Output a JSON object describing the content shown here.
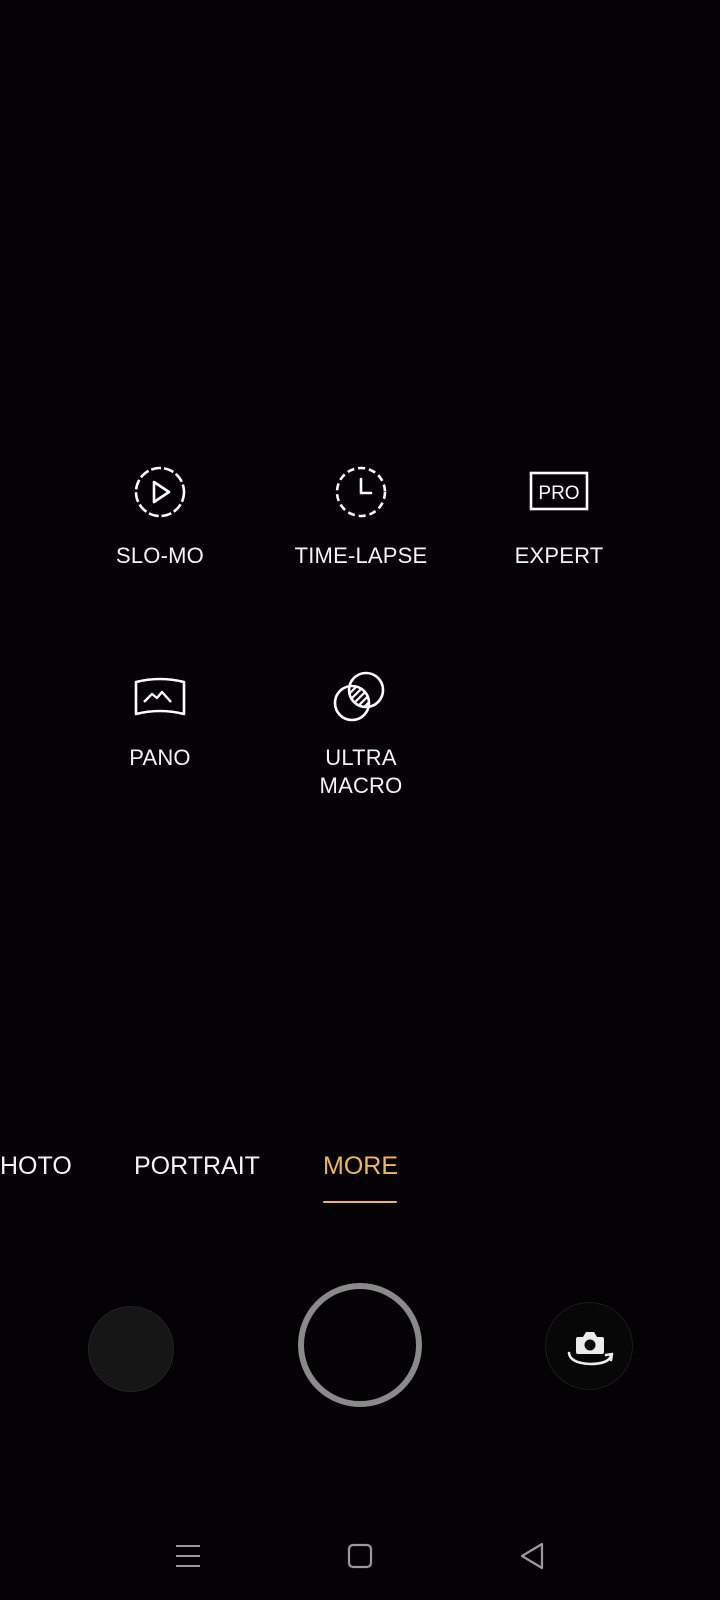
{
  "more_modes": [
    {
      "icon": "slow-motion-icon",
      "label": "SLO-MO"
    },
    {
      "icon": "time-lapse-icon",
      "label": "TIME-LAPSE"
    },
    {
      "icon": "pro-icon",
      "icon_text": "PRO",
      "label": "EXPERT"
    },
    {
      "icon": "panorama-icon",
      "label": "PANO"
    },
    {
      "icon": "ultra-macro-icon",
      "label": "ULTRA\nMACRO"
    }
  ],
  "mode_tabs": [
    {
      "label": "HOTO",
      "active": false
    },
    {
      "label": "PORTRAIT",
      "active": false
    },
    {
      "label": "MORE",
      "active": true
    }
  ],
  "colors": {
    "background": "#040205",
    "active_tab": "#f0b757",
    "shutter_ring": "#8a8a8a"
  },
  "controls": {
    "gallery": "gallery-thumbnail",
    "shutter": "shutter-button",
    "switch_camera": "switch-camera-icon"
  },
  "nav_bar": [
    "menu-icon",
    "home-icon",
    "back-icon"
  ]
}
